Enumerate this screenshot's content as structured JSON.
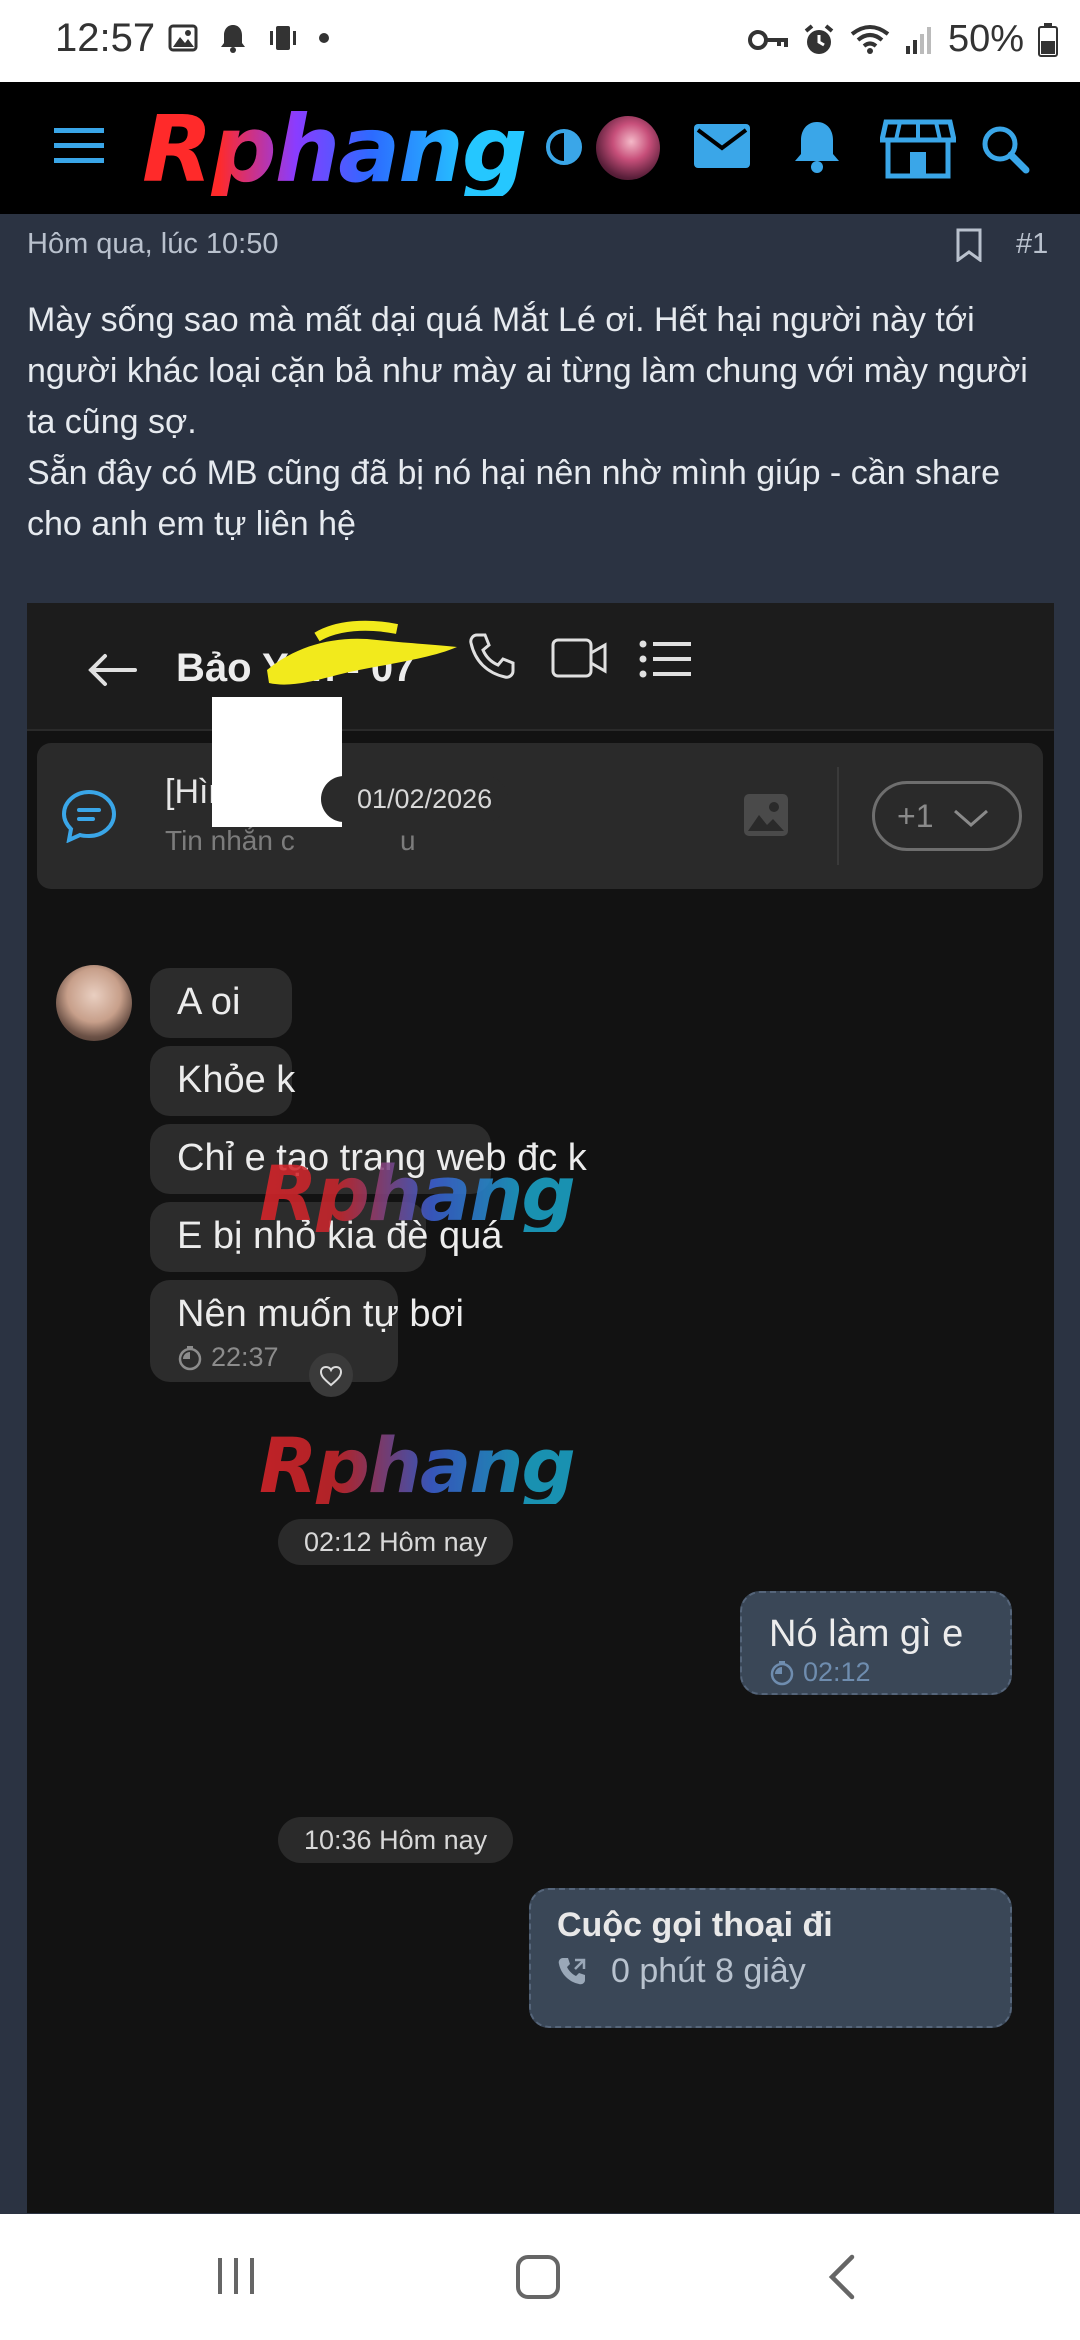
{
  "status_bar": {
    "time": "12:57",
    "battery": "50%"
  },
  "header": {
    "logo": "Rphang",
    "icons": [
      "menu-icon",
      "contrast-icon",
      "avatar",
      "mail-icon",
      "bell-icon",
      "store-icon",
      "search-icon"
    ]
  },
  "post": {
    "meta": "Hôm qua, lúc 10:50",
    "number": "#1",
    "body": [
      "Mày sống sao mà mất dại quá Mắt Lé ơi. Hết hại người này tới người khác loại cặn bả như mày ai từng làm chung với mày người ta cũng sợ.",
      "Sẵn đây có MB cũng đã bị nó hại nên nhờ mình giúp - cần share cho anh em tự liên hệ"
    ]
  },
  "chat": {
    "title": "Bảo Yến - 07",
    "pinned": {
      "title": "[Hình ảnh",
      "subtitle": "Tin nhắn c",
      "subtitle_tail": "u",
      "count": "+1"
    },
    "date_top": "01/02/2026",
    "messages_in": [
      {
        "text": "A oi"
      },
      {
        "text": "Khỏe k"
      },
      {
        "text": "Chỉ e tạo trang web đc k"
      },
      {
        "text": "E bị nhỏ kia đè quá"
      },
      {
        "text": "Nên muốn tự bơi",
        "time": "22:37"
      }
    ],
    "divider_1": "02:12 Hôm nay",
    "message_out": {
      "text": "Nó làm gì e",
      "time": "02:12"
    },
    "divider_2": "10:36 Hôm nay",
    "call": {
      "title": "Cuộc gọi thoại đi",
      "duration": "0 phút 8 giây"
    },
    "watermark": "Rphang"
  },
  "colors": {
    "page_bg": "#2b3342",
    "header_bg": "#000000",
    "accent": "#3aa6e8",
    "chat_bg": "#121212",
    "bubble_in": "#2c2c2c",
    "bubble_out": "#3a4757"
  }
}
